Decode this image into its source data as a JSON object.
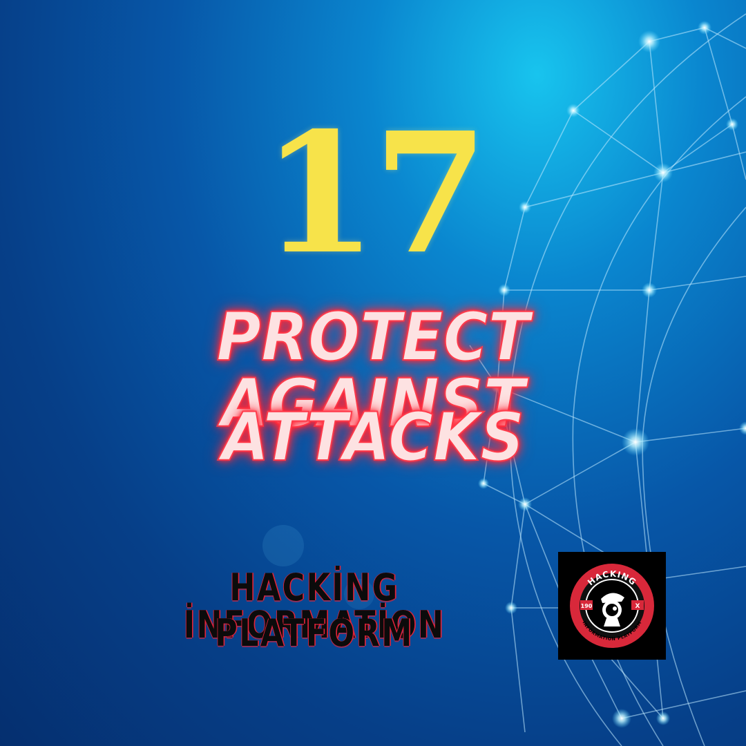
{
  "number": "17",
  "headline": {
    "line1": "PROTECT AGAINST",
    "line2": "ATTACKS"
  },
  "brand": {
    "line1": "HACKİNG İNFORMATİON",
    "line2": "PLATFORM"
  },
  "logo": {
    "top_text": "HACKING",
    "bottom_text": "INFORMATION PLATFORM",
    "left_badge": "190",
    "right_badge": "X"
  },
  "colors": {
    "number": "#f7e34a",
    "headline_fill": "#fde2e2",
    "headline_glow": "#ff2a3a",
    "brand_text": "#0b0b0b",
    "brand_shadow": "#e2233a",
    "logo_ring": "#d8283a"
  }
}
